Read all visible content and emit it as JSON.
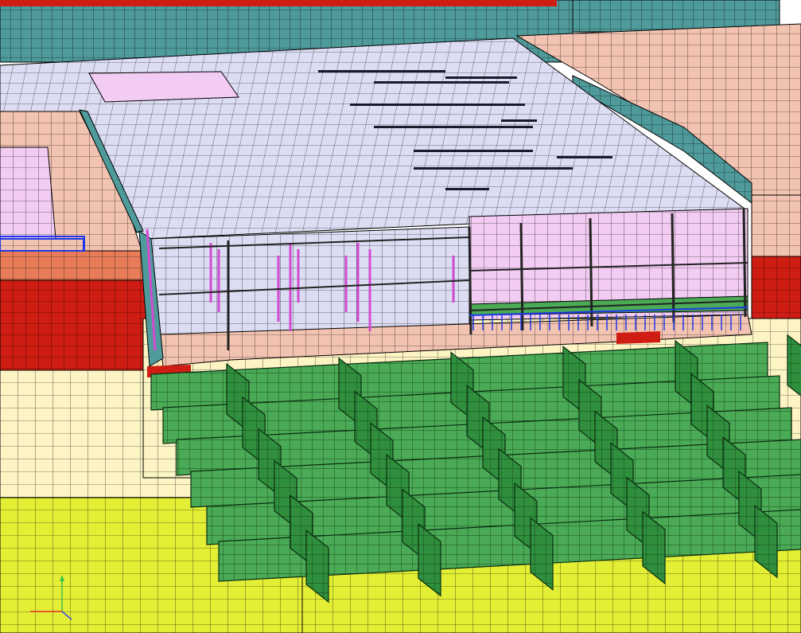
{
  "scene": {
    "description_colors": {
      "soil_topsoil": "#f6b8a6",
      "soil_salmon": "#f3c3b1",
      "soil_orange": "#e87c59",
      "soil_red": "#d01d13",
      "soil_cream": "#fdf4c4",
      "soil_lightyellow": "#f7f3a2",
      "soil_yellow": "#e3ef35",
      "slab_lavender": "#dcdcf3",
      "wall_pink": "#f2ccf2",
      "wall_teal": "#4f9a9a",
      "wall_teal_dark": "#3c8787",
      "pile_green": "#4aaa55",
      "pile_green_dark": "#2f8f3c",
      "strut_blue": "#1e38e6",
      "strut_magenta": "#d24ad2",
      "mesh_line": "#000000"
    },
    "axis_triad": {
      "x_color": "#e8282d",
      "y_color": "#38c24a",
      "z_color": "#3a4fe6"
    }
  }
}
